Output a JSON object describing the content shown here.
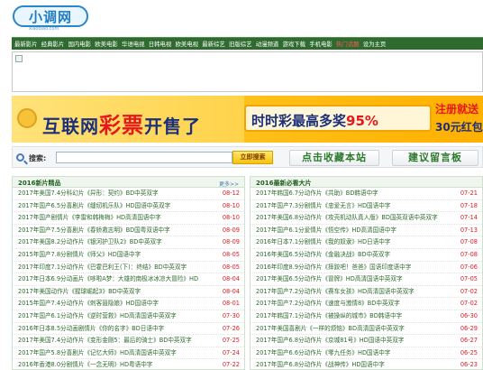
{
  "logo": {
    "text": "小调网",
    "sub": "xiaodiao.com"
  },
  "nav": [
    "最新影片",
    "经典影片",
    "国内电影",
    "欧美电影",
    "华语电视",
    "日韩电视",
    "欧美电视",
    "最新综艺",
    "旧版综艺",
    "动漫频道",
    "游戏下载",
    "手机电影",
    "热门话题",
    "设为主页"
  ],
  "banner": {
    "t1_pre": "互联网",
    "t1_red": "彩票",
    "t1_post": "开售了",
    "t2_pre": "时时彩最高多奖",
    "t2_red": "95%",
    "reg": "注册就送",
    "bonus": "30元红包"
  },
  "search": {
    "label": "搜索:",
    "value": "",
    "button": "立即搜索",
    "fav": "点击收藏本站",
    "msg": "建议留言板"
  },
  "left_panel": {
    "title": "2016新片精品",
    "more": "更多>>",
    "rows": [
      {
        "title": "2017年美国7.4分科幻片《异形：契约》BD中英双字",
        "date": "08-12"
      },
      {
        "title": "2017年国产6.5分喜剧片《缝纫机乐队》HD国语中英双字",
        "date": "08-10"
      },
      {
        "title": "2017年国产剧情片《李雷和韩梅梅》HD高清国语中字",
        "date": "08-10"
      },
      {
        "title": "2017年国产7.5分喜剧片《春娇救志明》BD国粤双语中字",
        "date": "08-09"
      },
      {
        "title": "2017年美国8.2分动作片《银河护卫队2》BD中英双字",
        "date": "08-09"
      },
      {
        "title": "2015年国产7.8分剧情片《师父》HD国语中字",
        "date": "08-05"
      },
      {
        "title": "2017年印度7.1分动作片《巴霍巴利王(下)：终结》BD中英双字",
        "date": "08-05"
      },
      {
        "title": "2017年日本6.9分动画片《哆啦A梦：大雄的南极冰冰凉大冒险》HD",
        "date": "08-04"
      },
      {
        "title": "2017年美国动作片《猩球崛起3》BD中英双字",
        "date": "08-04"
      },
      {
        "title": "2015年国产7.4分动作片《刺客聂隐娘》HD国语中字",
        "date": "08-01"
      },
      {
        "title": "2017年国产6.1分动作片《逆时营救》HD高清国语中英双字",
        "date": "07-30"
      },
      {
        "title": "2016年日本8.5分动画剧情片《你的名字》BD日语中字",
        "date": "07-26"
      },
      {
        "title": "2017年美国7.4分动作片《变形金刚5：最后的骑士》BD中英双字",
        "date": "07-25"
      },
      {
        "title": "2017年国产5.8分喜剧片《记忆大师》HD高清国语中英双字",
        "date": "07-24"
      },
      {
        "title": "2016年香港8.0分剧情片《一念无明》HD粤语中字",
        "date": "07-22"
      }
    ]
  },
  "right_panel": {
    "title": "2016最新必看大片",
    "rows": [
      {
        "title": "2017年韩国6.7分动作片《共助》BD韩语中字",
        "date": "07-21"
      },
      {
        "title": "2017年国产7.3分剧情片《忠爱无言》HD国语中字",
        "date": "07-18"
      },
      {
        "title": "2017年美国6.8分动作片《攻壳机动队真人版》BD国英双语中英双字",
        "date": "07-14"
      },
      {
        "title": "2017年国产6.1分爱情片《悟空传》HD高清国语中字",
        "date": "07-13"
      },
      {
        "title": "2016年日本7.1分剧情片《我的奴隶》HD日语中字",
        "date": "07-08"
      },
      {
        "title": "2016年美国6.5分动作片《金融决战》BD中英双字",
        "date": "07-08"
      },
      {
        "title": "2016年印度8.9分动作片《摔跤吧！爸爸》国语印度语中字",
        "date": "07-06"
      },
      {
        "title": "2017年美国6.5分动作片《冒牌》HD高清国语中英双字",
        "date": "07-05"
      },
      {
        "title": "2017年国产7.2分动作片《赛车女孩》HD高清国语中英双字",
        "date": "07-02"
      },
      {
        "title": "2017年国产7.2分动作片《速度与激情8》BD中英双字",
        "date": "07-02"
      },
      {
        "title": "2017年韩国7.1分动作片《被操纵的城市》BD韩语中字",
        "date": "06-30"
      },
      {
        "title": "2017年美国喜剧片《一样的烦恼》BD高清国语中英双字",
        "date": "06-29"
      },
      {
        "title": "2017年国产6.8分动作片《京城81号》HD国语中英双字",
        "date": "06-27"
      },
      {
        "title": "2017年国产6.6分动作片《零九任务》HD国语中字",
        "date": "06-25"
      },
      {
        "title": "2017年国产6.8分动作片《战神传》HD国语中字",
        "date": "06-23"
      }
    ]
  }
}
